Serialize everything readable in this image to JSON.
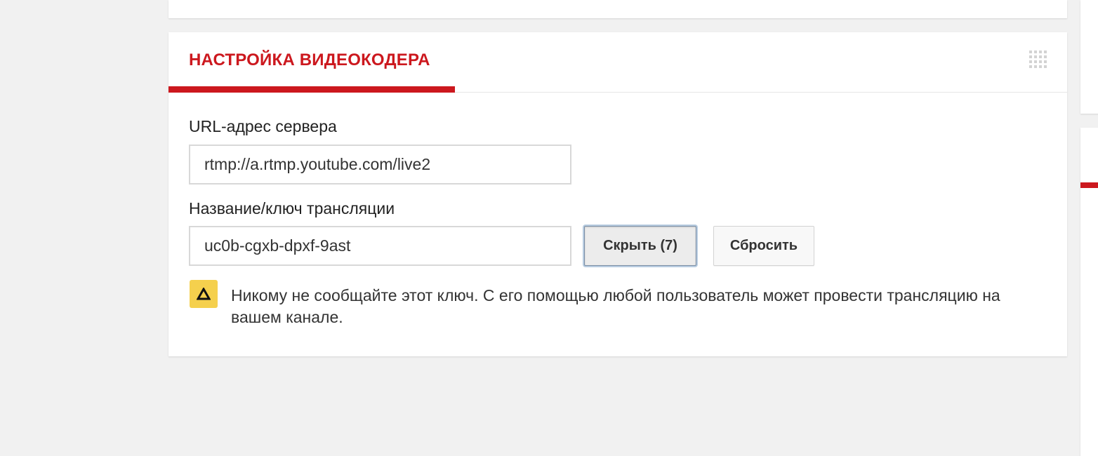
{
  "encoder_card": {
    "title": "НАСТРОЙКА ВИДЕОКОДЕРА",
    "server_url_label": "URL-адрес сервера",
    "server_url_value": "rtmp://a.rtmp.youtube.com/live2",
    "stream_key_label": "Название/ключ трансляции",
    "stream_key_value": "uc0b-cgxb-dpxf-9ast",
    "hide_button_label": "Скрыть (7)",
    "reset_button_label": "Сбросить",
    "warning_text": "Никому не сообщайте этот ключ. С его помощью любой пользователь может провести трансляцию на вашем канале.",
    "warning_icon": "warning-triangle-icon",
    "drag_icon": "drag-handle-icon"
  },
  "colors": {
    "accent_red": "#cc181e",
    "warning_yellow": "#f5d04d",
    "background": "#f1f1f1"
  }
}
